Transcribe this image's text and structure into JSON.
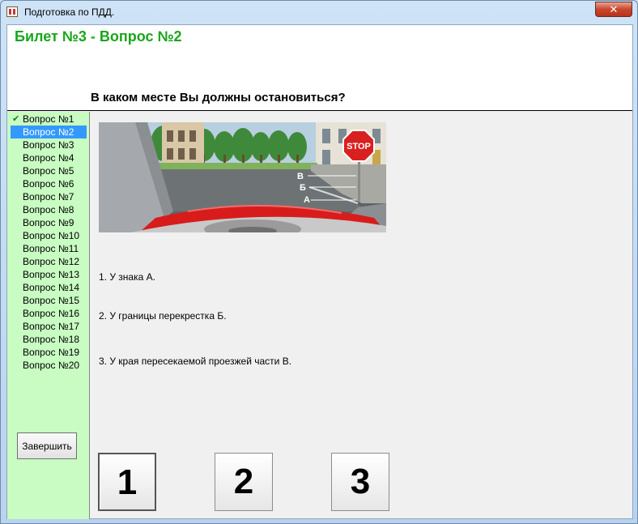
{
  "window": {
    "title": "Подготовка по ПДД.",
    "close_label": "✕"
  },
  "header": {
    "ticket_title": "Билет №3 - Вопрос №2",
    "question": "В каком месте Вы должны остановиться?"
  },
  "sidebar": {
    "items": [
      {
        "label": "Вопрос №1",
        "answered": true
      },
      {
        "label": "Вопрос №2",
        "selected": true
      },
      {
        "label": "Вопрос №3"
      },
      {
        "label": "Вопрос №4"
      },
      {
        "label": "Вопрос №5"
      },
      {
        "label": "Вопрос №6"
      },
      {
        "label": "Вопрос №7"
      },
      {
        "label": "Вопрос №8"
      },
      {
        "label": "Вопрос №9"
      },
      {
        "label": "Вопрос №10"
      },
      {
        "label": "Вопрос №11"
      },
      {
        "label": "Вопрос №12"
      },
      {
        "label": "Вопрос №13"
      },
      {
        "label": "Вопрос №14"
      },
      {
        "label": "Вопрос №15"
      },
      {
        "label": "Вопрос №16"
      },
      {
        "label": "Вопрос №17"
      },
      {
        "label": "Вопрос №18"
      },
      {
        "label": "Вопрос №19"
      },
      {
        "label": "Вопрос №20"
      }
    ],
    "finish_label": "Завершить"
  },
  "scene": {
    "stop_sign": "STOP",
    "markers": [
      "В",
      "Б",
      "А"
    ]
  },
  "answers": [
    "1. У знака А.",
    "2. У границы перекрестка Б.",
    "3. У края пересекаемой проезжей части В."
  ],
  "answer_buttons": [
    "1",
    "2",
    "3"
  ],
  "colors": {
    "title_green": "#19a61c",
    "sidebar_bg": "#c8fcc2",
    "selected": "#3399ff"
  }
}
